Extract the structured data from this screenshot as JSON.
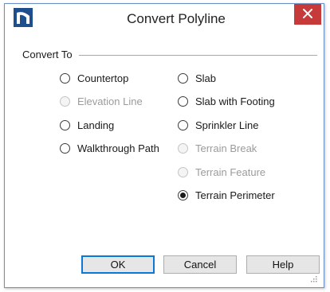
{
  "window": {
    "title": "Convert Polyline",
    "close_icon": "close-icon",
    "app_icon": "app-logo-icon",
    "colors": {
      "close": "#c73a3a",
      "border": "#6b8fc2",
      "default_button": "#0a78d7"
    }
  },
  "group": {
    "label": "Convert To"
  },
  "options": [
    {
      "id": "countertop",
      "label": "Countertop",
      "enabled": true,
      "selected": false
    },
    {
      "id": "elevation-line",
      "label": "Elevation Line",
      "enabled": false,
      "selected": false
    },
    {
      "id": "landing",
      "label": "Landing",
      "enabled": true,
      "selected": false
    },
    {
      "id": "walkthrough-path",
      "label": "Walkthrough Path",
      "enabled": true,
      "selected": false
    },
    {
      "id": "slab",
      "label": "Slab",
      "enabled": true,
      "selected": false
    },
    {
      "id": "slab-with-footing",
      "label": "Slab with Footing",
      "enabled": true,
      "selected": false
    },
    {
      "id": "sprinkler-line",
      "label": "Sprinkler Line",
      "enabled": true,
      "selected": false
    },
    {
      "id": "terrain-break",
      "label": "Terrain Break",
      "enabled": false,
      "selected": false
    },
    {
      "id": "terrain-feature",
      "label": "Terrain Feature",
      "enabled": false,
      "selected": false
    },
    {
      "id": "terrain-perimeter",
      "label": "Terrain Perimeter",
      "enabled": true,
      "selected": true
    }
  ],
  "buttons": {
    "ok": "OK",
    "cancel": "Cancel",
    "help": "Help"
  }
}
